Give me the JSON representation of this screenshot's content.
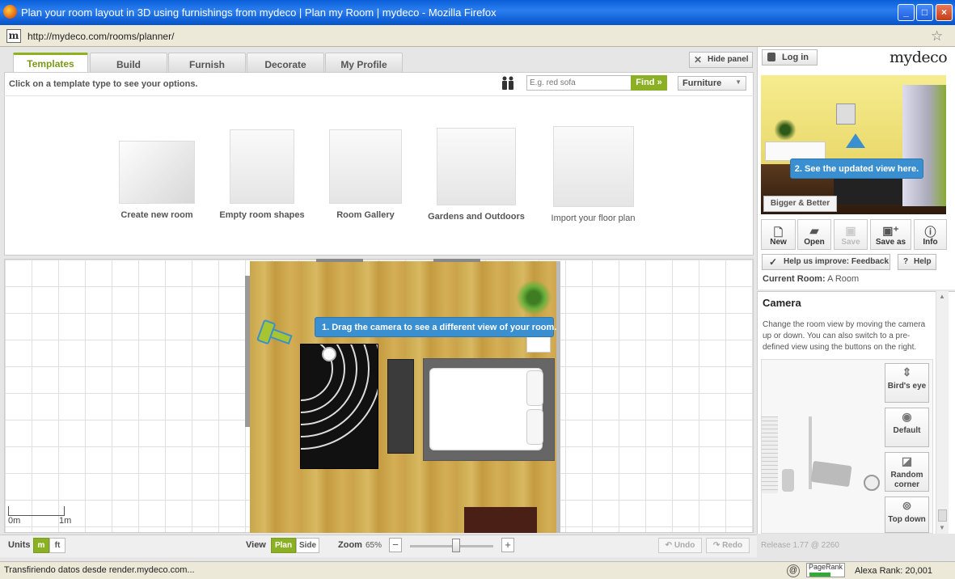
{
  "window": {
    "title": "Plan your room layout in 3D using furnishings from mydeco | Plan my Room | mydeco - Mozilla Firefox",
    "minimize": "_",
    "maximize": "□",
    "close": "×"
  },
  "addressbar": {
    "url": "http://mydeco.com/rooms/planner/",
    "favicon": "m"
  },
  "tabs": [
    {
      "label": "Templates"
    },
    {
      "label": "Build"
    },
    {
      "label": "Furnish"
    },
    {
      "label": "Decorate"
    },
    {
      "label": "My Profile"
    }
  ],
  "hide_panel": "Hide panel",
  "templates": {
    "hint": "Click on a template type to see your options.",
    "search_placeholder": "E.g. red sofa",
    "find_label": "Find",
    "category": "Furniture",
    "items": [
      {
        "label": "Create new room"
      },
      {
        "label": "Empty room shapes"
      },
      {
        "label": "Room Gallery"
      },
      {
        "label": "Gardens and Outdoors"
      },
      {
        "label": "Import your floor plan"
      }
    ]
  },
  "plan": {
    "tooltip": "1. Drag the camera to see a different view of your room.",
    "scale_start": "0m",
    "scale_end": "1m"
  },
  "bottombar": {
    "units_label": "Units",
    "unit_m": "m",
    "unit_ft": "ft",
    "view_label": "View",
    "view_plan": "Plan",
    "view_side": "Side",
    "zoom_label": "Zoom",
    "zoom_value": "65%",
    "zoom_fraction": 0.55,
    "zoom_out": "−",
    "zoom_in": "+",
    "undo": "Undo",
    "redo": "Redo"
  },
  "right": {
    "login": "Log in",
    "logo": "mydeco",
    "tooltip": "2. See the updated view here.",
    "bigger_button": "Bigger & Better",
    "toolbar": [
      {
        "label": "New",
        "icon": "new-doc-icon",
        "enabled": true
      },
      {
        "label": "Open",
        "icon": "open-folder-icon",
        "enabled": true
      },
      {
        "label": "Save",
        "icon": "save-icon",
        "enabled": false
      },
      {
        "label": "Save as",
        "icon": "save-as-icon",
        "enabled": true
      },
      {
        "label": "Info",
        "icon": "info-icon",
        "enabled": true
      }
    ],
    "feedback": "Help us improve: Feedback",
    "help": "Help",
    "current_room_label": "Current Room:",
    "current_room_value": "A Room",
    "camera": {
      "title": "Camera",
      "description": "Change the room view by moving the camera up or down. You can also switch to a pre-defined view using the buttons on the right.",
      "buttons": [
        {
          "label": "Bird's eye",
          "icon": "birds-eye-icon"
        },
        {
          "label": "Default",
          "icon": "eye-icon"
        },
        {
          "label": "Random corner",
          "icon": "random-corner-icon"
        },
        {
          "label": "Top down",
          "icon": "top-down-icon"
        }
      ]
    },
    "release": "Release 1.77 @ 2260"
  },
  "statusbar": {
    "text": "Transfiriendo datos desde render.mydeco.com...",
    "pagerank": "PageRank",
    "alexa": "Alexa Rank: 20,001"
  },
  "colors": {
    "accent": "#8bb024",
    "tooltip": "#3a8fd0",
    "titlebar": "#0a5fd8"
  }
}
